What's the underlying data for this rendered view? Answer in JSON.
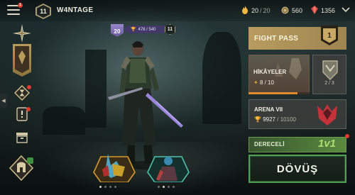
{
  "topbar": {
    "username": "W4NTAGE",
    "player_level": "11",
    "menu_badge": "1",
    "energy": {
      "current": "20",
      "max": "20"
    },
    "coins": "560",
    "gems": "1356"
  },
  "player": {
    "rank": "20",
    "xp": "478 / 540",
    "level": "11"
  },
  "right_panel": {
    "fight_pass": {
      "label": "FIGHT PASS",
      "level": "1"
    },
    "stories": {
      "label": "HİKÂYELER",
      "progress": "8 / 10",
      "progress_fraction": 0.8
    },
    "chest": {
      "progress": "2 / 3"
    },
    "arena": {
      "label": "ARENA VII",
      "trophies": "9927",
      "trophies_next": "10100"
    },
    "mode": {
      "label": "DERECELİ",
      "value": "1v1"
    },
    "fight_button": "DÖVÜŞ"
  },
  "carousel": {
    "pages": 4,
    "active": 1
  },
  "colors": {
    "gold": "#b89c5e",
    "fight_green": "#4fa055",
    "mode_green": "#5a8a3f",
    "stories_orange": "#e08a2c",
    "badge_red": "#e03a32",
    "rank_purple": "#7a6ab0"
  }
}
